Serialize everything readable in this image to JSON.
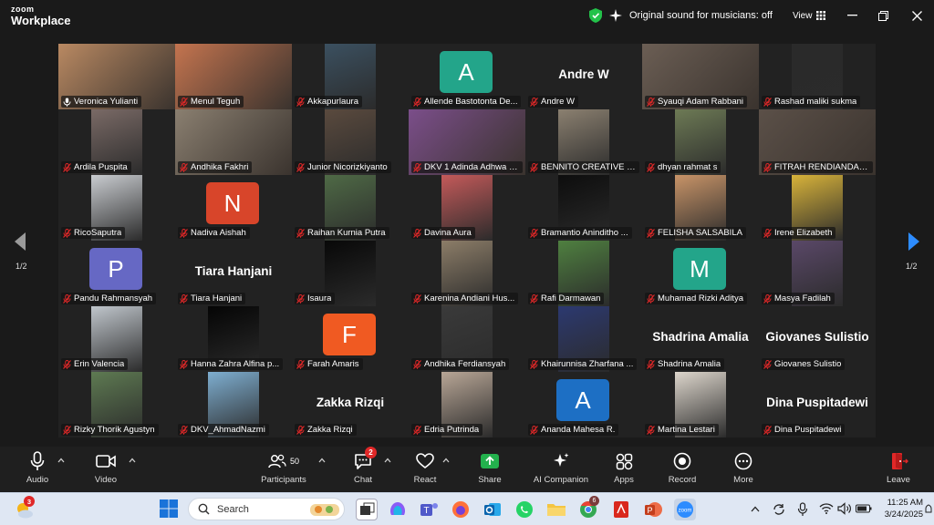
{
  "titlebar": {
    "logo_line1": "zoom",
    "logo_line2": "Workplace",
    "sound_status": "Original sound for musicians: off",
    "view_label": "View"
  },
  "pagination": {
    "left": "1/2",
    "right": "1/2"
  },
  "participants": [
    {
      "name": "Veronica Yulianti",
      "type": "video",
      "mic": "on",
      "speaking": true,
      "bg": "#b98962"
    },
    {
      "name": "Menul Teguh",
      "type": "video",
      "mic": "off",
      "bg": "#c4744f"
    },
    {
      "name": "Akkapurlaura",
      "type": "thumb",
      "mic": "off",
      "bg": "#3b5060"
    },
    {
      "name": "Allende Bastotonta De...",
      "type": "letter",
      "letter": "A",
      "color": "#23a58a",
      "mic": "off"
    },
    {
      "name": "Andre W",
      "type": "bigname",
      "big": "Andre W",
      "mic": "off"
    },
    {
      "name": "Syauqi Adam Rabbani",
      "type": "video",
      "mic": "off",
      "bg": "#6b5e54"
    },
    {
      "name": "Rashad maliki sukma",
      "type": "thumb",
      "mic": "off",
      "bg": "#2a2a2a"
    },
    {
      "name": "Ardila Puspita",
      "type": "thumb",
      "mic": "off",
      "bg": "#7a6a66"
    },
    {
      "name": "Andhika Fakhri",
      "type": "video",
      "mic": "off",
      "bg": "#8a7f70"
    },
    {
      "name": "Junior Nicorizkiyanto",
      "type": "thumb",
      "mic": "off",
      "bg": "#5a4a3e"
    },
    {
      "name": "DKV 1 Adinda Adhwa O...",
      "type": "video",
      "mic": "off",
      "bg": "#7b4e8a"
    },
    {
      "name": "BENNITO CREATIVE & ...",
      "type": "thumb",
      "mic": "off",
      "bg": "#8b8070"
    },
    {
      "name": "dhyan rahmat s",
      "type": "thumb",
      "mic": "off",
      "bg": "#6d7a55"
    },
    {
      "name": "FITRAH RENDIANDARA",
      "type": "video",
      "mic": "off",
      "bg": "#5b5048"
    },
    {
      "name": "RicoSaputra",
      "type": "thumb",
      "mic": "off",
      "bg": "#c9ccd0"
    },
    {
      "name": "Nadiva Aishah",
      "type": "letter",
      "letter": "N",
      "color": "#d8452a",
      "mic": "off"
    },
    {
      "name": "Raihan Kurnia Putra",
      "type": "thumb",
      "mic": "off",
      "bg": "#4f6a46"
    },
    {
      "name": "Davina Aura",
      "type": "thumb",
      "mic": "off",
      "bg": "#c45a5a"
    },
    {
      "name": "Bramantio Aninditho ...",
      "type": "thumb",
      "mic": "off",
      "bg": "#0d0d0d"
    },
    {
      "name": "FELISHA SALSABILA",
      "type": "thumb",
      "mic": "off",
      "bg": "#c89468"
    },
    {
      "name": "Irene Elizabeth",
      "type": "thumb",
      "mic": "off",
      "bg": "#d8b33a"
    },
    {
      "name": "Pandu Rahmansyah",
      "type": "letter",
      "letter": "P",
      "color": "#6668c4",
      "mic": "off"
    },
    {
      "name": "Tiara Hanjani",
      "type": "bigname",
      "big": "Tiara Hanjani",
      "mic": "off"
    },
    {
      "name": "Isaura",
      "type": "thumb",
      "mic": "off",
      "bg": "#080808"
    },
    {
      "name": "Karenina Andiani Hus...",
      "type": "thumb",
      "mic": "off",
      "bg": "#8c7d68"
    },
    {
      "name": "Rafi Darmawan",
      "type": "thumb",
      "mic": "off",
      "bg": "#4f8040"
    },
    {
      "name": "Muhamad Rizki Aditya",
      "type": "letter",
      "letter": "M",
      "color": "#23a58a",
      "mic": "off"
    },
    {
      "name": "Masya Fadilah",
      "type": "thumb",
      "mic": "off",
      "bg": "#5a4868"
    },
    {
      "name": "Erin Valencia",
      "type": "thumb",
      "mic": "off",
      "bg": "#c0c6cc"
    },
    {
      "name": "Hanna Zahra Alfina p...",
      "type": "thumb",
      "mic": "off",
      "bg": "#050505"
    },
    {
      "name": "Farah Amaris",
      "type": "letter",
      "letter": "F",
      "color": "#f05a22",
      "mic": "off"
    },
    {
      "name": "Andhika Ferdiansyah",
      "type": "thumb",
      "mic": "off",
      "bg": "#3a3a3a"
    },
    {
      "name": "Khairunnisa Zharfana ...",
      "type": "thumb",
      "mic": "off",
      "bg": "#2c3970"
    },
    {
      "name": "Shadrina Amalia",
      "type": "bigname",
      "big": "Shadrina Amalia",
      "mic": "off"
    },
    {
      "name": "Giovanes Sulistio",
      "type": "bigname",
      "big": "Giovanes Sulistio",
      "mic": "off"
    },
    {
      "name": "Rizky Thorik Agustyn",
      "type": "thumb",
      "mic": "off",
      "bg": "#5e7a52"
    },
    {
      "name": "DKV_AhmadNazmi",
      "type": "thumb",
      "mic": "off",
      "bg": "#7eaed0"
    },
    {
      "name": "Zakka Rizqi",
      "type": "bigname",
      "big": "Zakka Rizqi",
      "mic": "off"
    },
    {
      "name": "Edria Putrinda",
      "type": "thumb",
      "mic": "off",
      "bg": "#b8a696"
    },
    {
      "name": "Ananda Mahesa R.",
      "type": "letter",
      "letter": "A",
      "color": "#1d6fc4",
      "mic": "off"
    },
    {
      "name": "Martina Lestari",
      "type": "thumb",
      "mic": "off",
      "bg": "#ddd6cc"
    },
    {
      "name": "Dina Puspitadewi",
      "type": "bigname",
      "big": "Dina Puspitadewi",
      "mic": "off"
    }
  ],
  "toolbar": {
    "audio": "Audio",
    "video": "Video",
    "participants": "Participants",
    "participants_count": "50",
    "chat": "Chat",
    "chat_badge": "2",
    "react": "React",
    "share": "Share",
    "ai_companion": "AI Companion",
    "apps": "Apps",
    "record": "Record",
    "more": "More",
    "leave": "Leave"
  },
  "taskbar": {
    "weather_badge": "3",
    "search_placeholder": "Search",
    "chrome_badge": "6",
    "time": "11:25 AM",
    "date": "3/24/2025"
  },
  "colors": {
    "speaking_outline": "#23d959",
    "share_green": "#23b14d",
    "mic_off_red": "#e02828"
  }
}
